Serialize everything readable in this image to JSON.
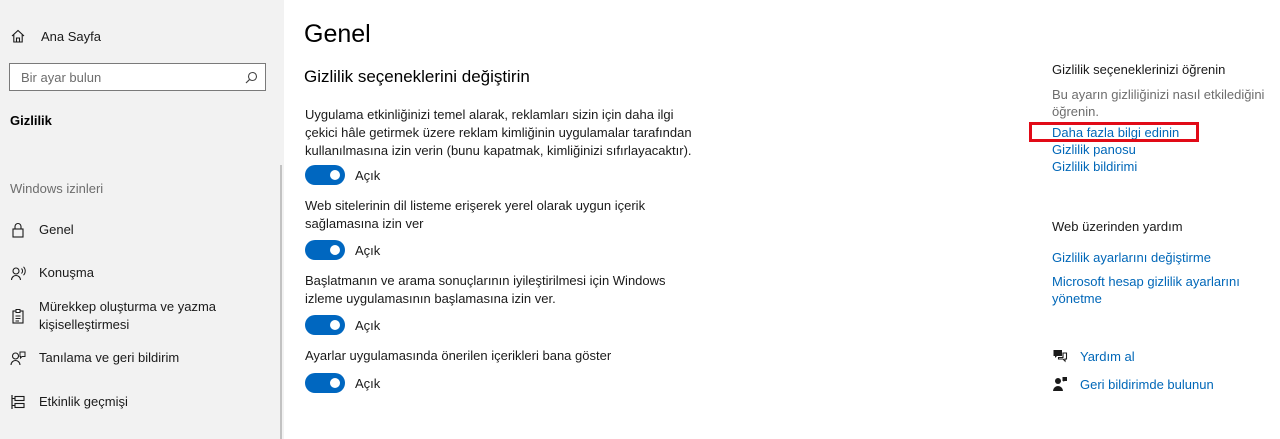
{
  "sidebar": {
    "home_label": "Ana Sayfa",
    "search_placeholder": "Bir ayar bulun",
    "section_title": "Gizlilik",
    "group_header": "Windows izinleri",
    "items": [
      {
        "label": "Genel",
        "icon": "lock-icon"
      },
      {
        "label": "Konuşma",
        "icon": "speech-icon"
      },
      {
        "label": "Mürekkep oluşturma ve yazma kişiselleştirmesi",
        "icon": "clipboard-icon"
      },
      {
        "label": "Tanılama ve geri bildirim",
        "icon": "feedback-icon"
      },
      {
        "label": "Etkinlik geçmişi",
        "icon": "timeline-icon"
      }
    ]
  },
  "main": {
    "title": "Genel",
    "section_heading": "Gizlilik seçeneklerini değiştirin",
    "settings": [
      {
        "description": "Uygulama etkinliğinizi temel alarak, reklamları sizin için daha ilgi çekici hâle getirmek üzere reklam kimliğinin uygulamalar tarafından kullanılmasına izin verin (bunu kapatmak, kimliğinizi sıfırlayacaktır).",
        "state": "Açık"
      },
      {
        "description": "Web sitelerinin dil listeme erişerek yerel olarak uygun içerik sağlamasına izin ver",
        "state": "Açık"
      },
      {
        "description": "Başlatmanın ve arama sonuçlarının iyileştirilmesi için Windows izleme uygulamasının başlamasına izin ver.",
        "state": "Açık"
      },
      {
        "description": "Ayarlar uygulamasında önerilen içerikleri bana göster",
        "state": "Açık"
      }
    ]
  },
  "right": {
    "learn_heading": "Gizlilik seçeneklerinizi öğrenin",
    "learn_text": "Bu ayarın gizliliğinizi nasıl etkilediğini öğrenin.",
    "links": [
      "Daha fazla bilgi edinin",
      "Gizlilik panosu",
      "Gizlilik bildirimi"
    ],
    "web_help_heading": "Web üzerinden yardım",
    "web_links": [
      "Gizlilik ayarlarını değiştirme",
      "Microsoft hesap gizlilik ayarlarını yönetme"
    ],
    "help_label": "Yardım al",
    "feedback_label": "Geri bildirimde bulunun"
  },
  "colors": {
    "accent": "#0067c0",
    "link": "#0067b8",
    "highlight": "#e10a17"
  }
}
